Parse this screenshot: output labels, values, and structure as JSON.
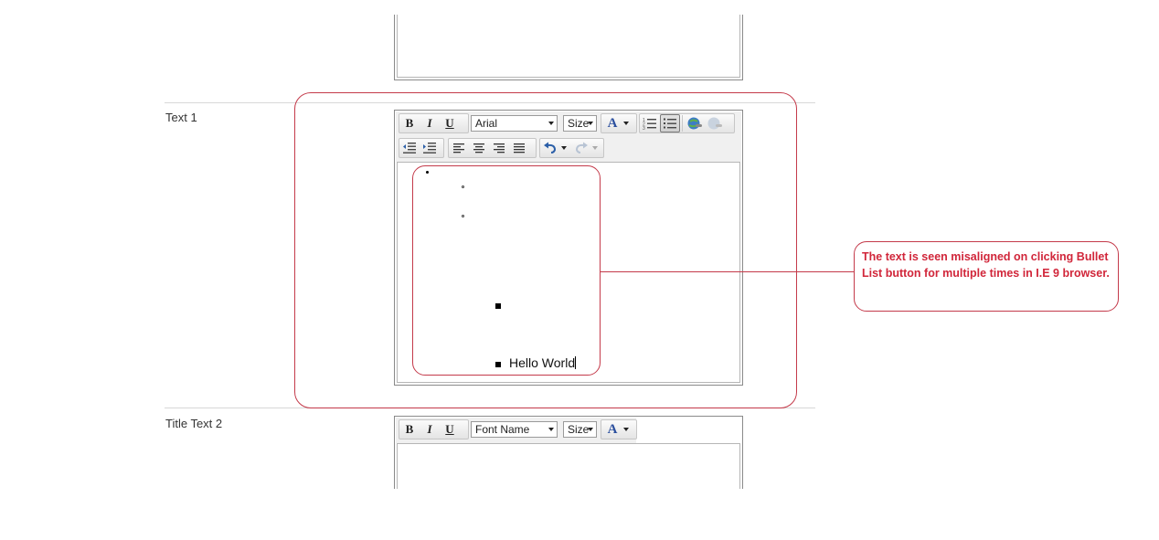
{
  "top_editor": {},
  "field_text1": {
    "label": "Text 1",
    "toolbar": {
      "bold": "B",
      "italic": "I",
      "underline": "U",
      "font_name": "Arial",
      "font_size": "Size",
      "font_color_glyph": "A"
    },
    "content": {
      "line_text": "Hello World"
    }
  },
  "field_title_text2": {
    "label": "Title Text 2",
    "toolbar": {
      "bold": "B",
      "italic": "I",
      "underline": "U",
      "font_name": "Font Name",
      "font_size": "Size",
      "font_color_glyph": "A"
    }
  },
  "annotation": {
    "text": "The text is seen misaligned on clicking Bullet List button for multiple times in I.E 9 browser.",
    "color": "#d1263a"
  },
  "icons": [
    "bold-icon",
    "italic-icon",
    "underline-icon",
    "font-color-icon",
    "numbered-list-icon",
    "bullet-list-icon",
    "insert-link-icon",
    "remove-link-icon",
    "outdent-icon",
    "indent-icon",
    "align-left-icon",
    "align-center-icon",
    "align-right-icon",
    "justify-icon",
    "undo-icon",
    "redo-icon"
  ]
}
